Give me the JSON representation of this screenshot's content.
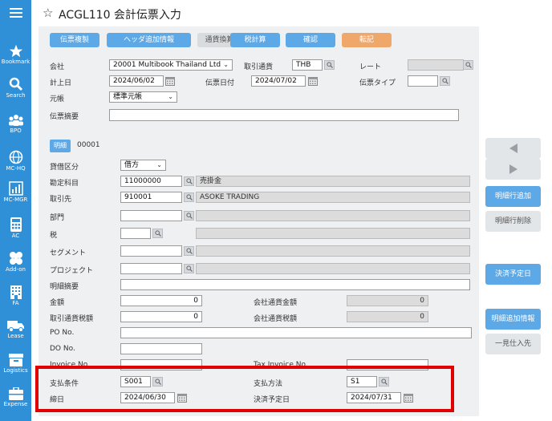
{
  "sidebar": {
    "items": [
      {
        "label": "",
        "icon": "hamburger-menu-icon"
      },
      {
        "label": "Bookmark",
        "icon": "star-icon"
      },
      {
        "label": "Search",
        "icon": "search-icon"
      },
      {
        "label": "BPO",
        "icon": "people-icon"
      },
      {
        "label": "MC-HQ",
        "icon": "globe-icon"
      },
      {
        "label": "MC-MGR",
        "icon": "bar-chart-icon"
      },
      {
        "label": "AC",
        "icon": "calculator-icon"
      },
      {
        "label": "Add-on",
        "icon": "puzzle-icon"
      },
      {
        "label": "FA",
        "icon": "building-icon"
      },
      {
        "label": "Lease",
        "icon": "truck-icon"
      },
      {
        "label": "Logistics",
        "icon": "box-icon"
      },
      {
        "label": "Expense",
        "icon": "briefcase-icon"
      }
    ]
  },
  "header": {
    "title": "ACGL110 会計伝票入力"
  },
  "toolbar": {
    "copy": "伝票複製",
    "header_add": "ヘッダ追加情報",
    "currency_convert": "通貨換算",
    "tax_calc": "税計算",
    "confirm": "確認",
    "transfer": "転記"
  },
  "form": {
    "company_label": "会社",
    "company_value": "20001 Multibook Thailand Ltd",
    "trans_currency_label": "取引通貨",
    "trans_currency_value": "THB",
    "rate_label": "レート",
    "posting_date_label": "計上日",
    "posting_date_value": "2024/06/02",
    "doc_date_label": "伝票日付",
    "doc_date_value": "2024/07/02",
    "doc_type_label": "伝票タイプ",
    "ledger_label": "元帳",
    "ledger_value": "標準元帳",
    "summary_label": "伝票摘要"
  },
  "detail": {
    "tab_label": "明細",
    "line_no": "00001",
    "dc_label": "貸借区分",
    "dc_value": "借方",
    "account_label": "勘定科目",
    "account_code": "11000000",
    "account_name": "売掛金",
    "partner_label": "取引先",
    "partner_code": "910001",
    "partner_name": "ASOKE TRADING",
    "dept_label": "部門",
    "tax_label": "税",
    "segment_label": "セグメント",
    "project_label": "プロジェクト",
    "line_summary_label": "明細摘要",
    "amount_label": "金額",
    "amount_value": "0",
    "company_amount_label": "会社通貨金額",
    "company_amount_value": "0",
    "trans_tax_label": "取引通貨税額",
    "trans_tax_value": "0",
    "company_tax_label": "会社通貨税額",
    "company_tax_value": "0",
    "po_label": "PO No.",
    "do_label": "DO No.",
    "invoice_label": "Invoice No.",
    "tax_invoice_label": "Tax Invoice No.",
    "pay_terms_label": "支払条件",
    "pay_terms_value": "S001",
    "pay_method_label": "支払方法",
    "pay_method_value": "S1",
    "closing_label": "締日",
    "closing_value": "2024/06/30",
    "due_label": "決済予定日",
    "due_value": "2024/07/31"
  },
  "right_panel": {
    "add_line": "明細行追加",
    "delete_line": "明細行削除",
    "due_date": "決済予定日",
    "line_add_info": "明細追加情報",
    "one_time_vendor": "一見仕入先"
  },
  "colors": {
    "sidebar": "#2f8fd7",
    "button_blue": "#5da8e6",
    "button_orange": "#f0a86a",
    "highlight": "#e00000"
  }
}
